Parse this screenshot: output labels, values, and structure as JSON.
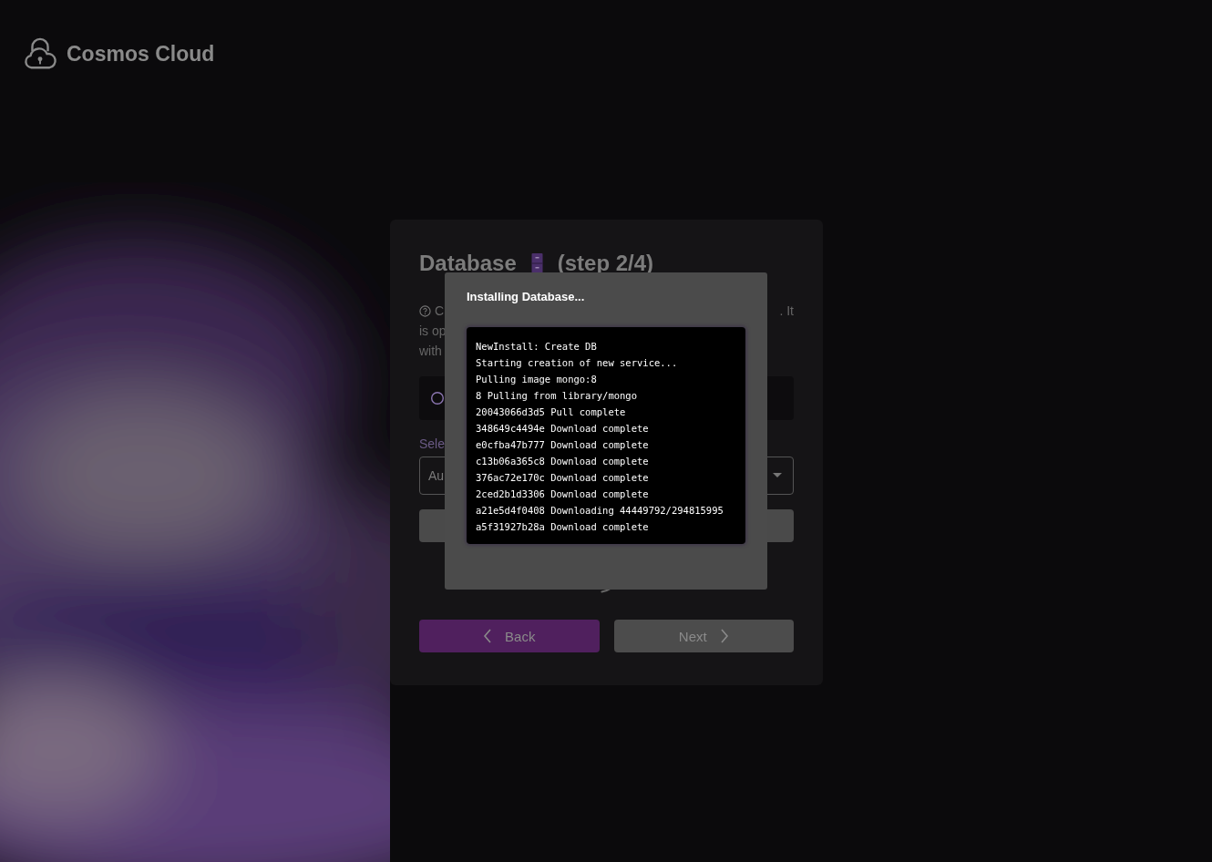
{
  "brand": {
    "name": "Cosmos Cloud"
  },
  "card": {
    "title": "Database",
    "step": "(step 2/4)",
    "help_fragments": [
      {
        "left": "C",
        "right": ". It"
      },
      {
        "left": "is op"
      },
      {
        "left": "with"
      }
    ],
    "select_label": "Sele",
    "select_value": "Au",
    "buttons": [
      {
        "label": "Back",
        "kind": "back",
        "disabled": false
      },
      {
        "label": "Next",
        "kind": "next",
        "disabled": true
      }
    ]
  },
  "modal": {
    "title": "Installing Database...",
    "log": [
      "NewInstall: Create DB",
      "Starting creation of new service...",
      "Pulling image mongo:8",
      "8 Pulling from library/mongo",
      "20043066d3d5 Pull complete",
      "348649c4494e Download complete",
      "e0cfba47b777 Download complete",
      "c13b06a365c8 Download complete",
      "376ac72e170c Download complete",
      "2ced2b1d3306 Download complete",
      "a21e5d4f0408 Downloading 44449792/294815995",
      "a5f31927b28a Download complete"
    ]
  }
}
